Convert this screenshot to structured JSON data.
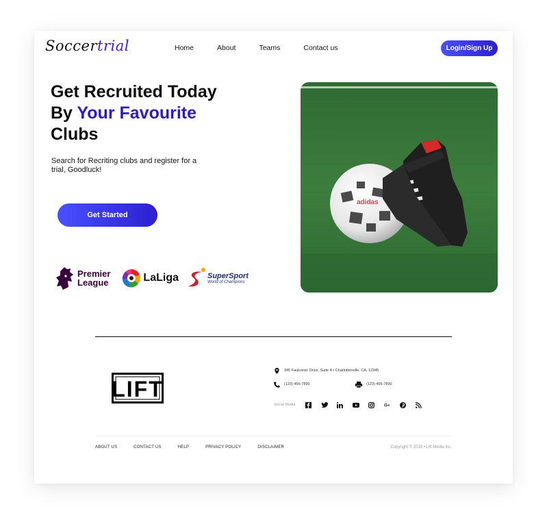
{
  "brand": {
    "logo_part1": "Soccer",
    "logo_part2": "trial",
    "accent_color": "#2e1bc4",
    "button_gradient": [
      "#4a50ff",
      "#2c1fd0"
    ]
  },
  "nav": {
    "items": [
      "Home",
      "About",
      "Teams",
      "Contact us"
    ],
    "login_label": "Login/Sign Up"
  },
  "hero": {
    "title_line1": "Get Recruited Today",
    "title_by": "By ",
    "title_accent": "Your Favourite",
    "title_line3": "Clubs",
    "subtitle": "Search for Recriting clubs and register for a trial, Goodluck!",
    "cta_label": "Get Started",
    "image_icon": "soccer-ball-and-boots-photo"
  },
  "partners": {
    "premier_league": [
      "Premier",
      "League"
    ],
    "laliga": "LaLiga",
    "supersport": [
      "SuperSport",
      "World of Champions"
    ]
  },
  "footer": {
    "address": "345 Faulconer Drive, Suite 4 • Charlottesville, CA, 12345",
    "phone": "(123) 456-7890",
    "fax": "(123) 456-7890",
    "social_label": "Social Media",
    "social_icons": [
      "facebook-icon",
      "twitter-icon",
      "linkedin-icon",
      "youtube-icon",
      "instagram-icon",
      "google-plus-icon",
      "pinterest-icon",
      "rss-icon"
    ],
    "links": [
      "ABOUT US",
      "CONTACT US",
      "HELP",
      "PRIVACY POLICY",
      "DISCLAIMER"
    ],
    "copyright": "Copyright © 2018 • Lift Media Inc."
  }
}
